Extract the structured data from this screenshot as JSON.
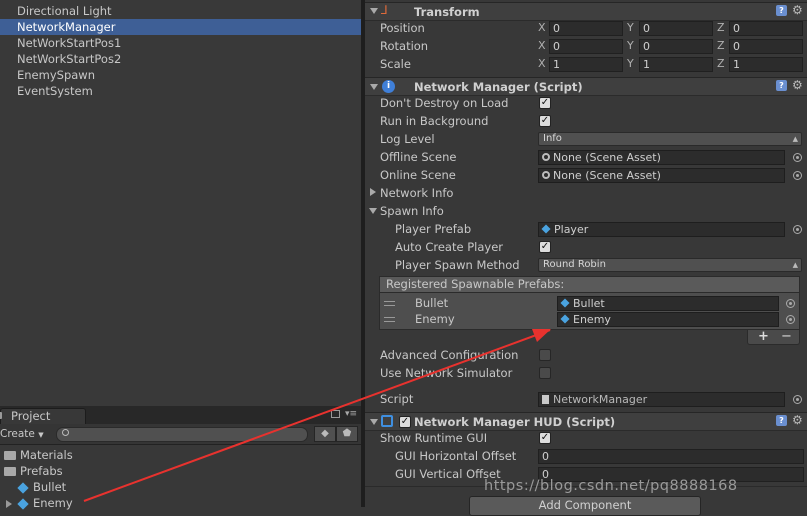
{
  "hierarchy": {
    "items": [
      {
        "label": "Directional Light",
        "selected": false
      },
      {
        "label": "NetworkManager",
        "selected": true
      },
      {
        "label": "NetWorkStartPos1",
        "selected": false
      },
      {
        "label": "NetWorkStartPos2",
        "selected": false
      },
      {
        "label": "EnemySpawn",
        "selected": false
      },
      {
        "label": "EventSystem",
        "selected": false
      }
    ]
  },
  "project": {
    "tab_label": "Project",
    "create_label": "Create",
    "tree": [
      {
        "label": "Materials",
        "type": "folder"
      },
      {
        "label": "Prefabs",
        "type": "folder"
      },
      {
        "label": "Bullet",
        "type": "prefab"
      },
      {
        "label": "Enemy",
        "type": "prefab"
      }
    ]
  },
  "transform": {
    "title": "Transform",
    "rows": [
      {
        "label": "Position",
        "x": "0",
        "y": "0",
        "z": "0"
      },
      {
        "label": "Rotation",
        "x": "0",
        "y": "0",
        "z": "0"
      },
      {
        "label": "Scale",
        "x": "1",
        "y": "1",
        "z": "1"
      }
    ],
    "axes": {
      "x": "X",
      "y": "Y",
      "z": "Z"
    }
  },
  "network_manager": {
    "title": "Network Manager (Script)",
    "dont_destroy_label": "Don't Destroy on Load",
    "dont_destroy": true,
    "run_bg_label": "Run in Background",
    "run_bg": true,
    "log_level_label": "Log Level",
    "log_level_value": "Info",
    "offline_scene_label": "Offline Scene",
    "offline_scene_value": "None (Scene Asset)",
    "online_scene_label": "Online Scene",
    "online_scene_value": "None (Scene Asset)",
    "network_info_label": "Network Info",
    "spawn_info_label": "Spawn Info",
    "player_prefab_label": "Player Prefab",
    "player_prefab_value": "Player",
    "auto_create_label": "Auto Create Player",
    "auto_create": true,
    "spawn_method_label": "Player Spawn Method",
    "spawn_method_value": "Round Robin",
    "registered_label": "Registered Spawnable Prefabs:",
    "registered": [
      {
        "label": "Bullet",
        "value": "Bullet"
      },
      {
        "label": "Enemy",
        "value": "Enemy"
      }
    ],
    "plus": "+",
    "minus": "−",
    "advanced_label": "Advanced Configuration",
    "advanced": false,
    "simulator_label": "Use Network Simulator",
    "simulator": false,
    "script_label": "Script",
    "script_value": "NetworkManager"
  },
  "hud": {
    "title": "Network Manager HUD (Script)",
    "show_gui_label": "Show Runtime GUI",
    "show_gui": true,
    "h_offset_label": "GUI Horizontal Offset",
    "h_offset_value": "0",
    "v_offset_label": "GUI Vertical Offset",
    "v_offset_value": "0"
  },
  "add_component_label": "Add Component",
  "watermark": "https://blog.csdn.net/pq8888168",
  "colors": {
    "selection": "#3e5f96",
    "arrow": "#e8322e",
    "prefab_icon": "#4aa3e0"
  }
}
